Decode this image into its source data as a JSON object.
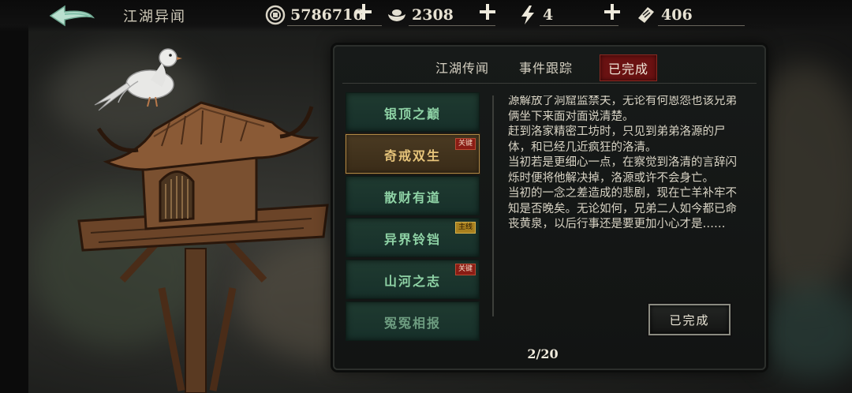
{
  "header": {
    "title": "江湖异闻",
    "resources": [
      {
        "icon": "coin-icon",
        "value": "5786716"
      },
      {
        "icon": "silver-ingot-icon",
        "value": "2308"
      },
      {
        "icon": "energy-bolt-icon",
        "value": "4"
      },
      {
        "icon": "ticket-icon",
        "value": "406"
      }
    ]
  },
  "tabs": [
    {
      "label": "江湖传闻",
      "active": false
    },
    {
      "label": "事件跟踪",
      "active": false
    },
    {
      "label": "已完成",
      "active": true
    }
  ],
  "quests": [
    {
      "label": "银顶之巅",
      "selected": false,
      "tag": ""
    },
    {
      "label": "奇戒双生",
      "selected": true,
      "tag": "关键"
    },
    {
      "label": "散财有道",
      "selected": false,
      "tag": ""
    },
    {
      "label": "异界铃铛",
      "selected": false,
      "tag": "主线"
    },
    {
      "label": "山河之志",
      "selected": false,
      "tag": "关键"
    },
    {
      "label": "冤冤相报",
      "selected": false,
      "tag": ""
    }
  ],
  "story_text": "源解放了洞窟监禁夫，无论有何恩怨也该兄弟俩坐下来面对面说清楚。\n赶到洛家精密工坊时，只见到弟弟洛源的尸体，和已经几近疯狂的洛清。\n当初若是更细心一点，在察觉到洛清的言辞闪烁时便将他解决掉，洛源或许不会身亡。\n当初的一念之差造成的悲剧，现在亡羊补牢不知是否晚矣。无论如何，兄弟二人如今都已命丧黄泉，以后行事还是要更加小心才是……",
  "done_button": "已完成",
  "pager": "2/20",
  "colors": {
    "accent_red": "#6a1212",
    "quest_green": "#8fd3a6",
    "selected_gold": "#e6c47a"
  }
}
